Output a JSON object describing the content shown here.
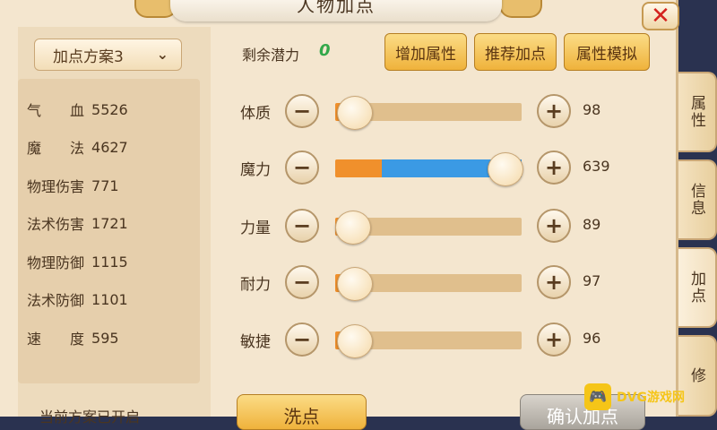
{
  "title": "人物加点",
  "plan_selector": {
    "label": "加点方案3",
    "chevron_icon": "chevron-down-icon"
  },
  "stats": [
    {
      "label": "气　　血",
      "value": "5526"
    },
    {
      "label": "魔　　法",
      "value": "4627"
    },
    {
      "label": "物理伤害",
      "value": "771"
    },
    {
      "label": "法术伤害",
      "value": "1721"
    },
    {
      "label": "物理防御",
      "value": "1115"
    },
    {
      "label": "法术防御",
      "value": "1101"
    },
    {
      "label": "速　　度",
      "value": "595"
    }
  ],
  "bottom_note": "当前方案已开启",
  "potential": {
    "label": "剩余潜力",
    "value": "0"
  },
  "top_buttons": {
    "add_attr": "增加属性",
    "recommend": "推荐加点",
    "simulate": "属性模拟"
  },
  "attributes": [
    {
      "label": "体质",
      "value": "98",
      "base_fraction": 0.1,
      "added_fraction": 0.0
    },
    {
      "label": "魔力",
      "value": "639",
      "base_fraction": 0.25,
      "added_fraction": 0.75
    },
    {
      "label": "力量",
      "value": "89",
      "base_fraction": 0.06,
      "added_fraction": 0.0
    },
    {
      "label": "耐力",
      "value": "97",
      "base_fraction": 0.1,
      "added_fraction": 0.0
    },
    {
      "label": "敏捷",
      "value": "96",
      "base_fraction": 0.1,
      "added_fraction": 0.0
    }
  ],
  "side_tabs": [
    {
      "label": "属性",
      "active": false
    },
    {
      "label": "信息",
      "active": false
    },
    {
      "label": "加点",
      "active": true
    },
    {
      "label": "修",
      "active": false
    }
  ],
  "bottom_buttons": {
    "wash": "洗点",
    "confirm": "确认加点"
  },
  "watermark": {
    "text": "DVG游戏网"
  },
  "colors": {
    "base_fill": "#f0902c",
    "added_fill": "#3b9ae4",
    "potential": "#33a84a",
    "close": "#d4221e"
  }
}
